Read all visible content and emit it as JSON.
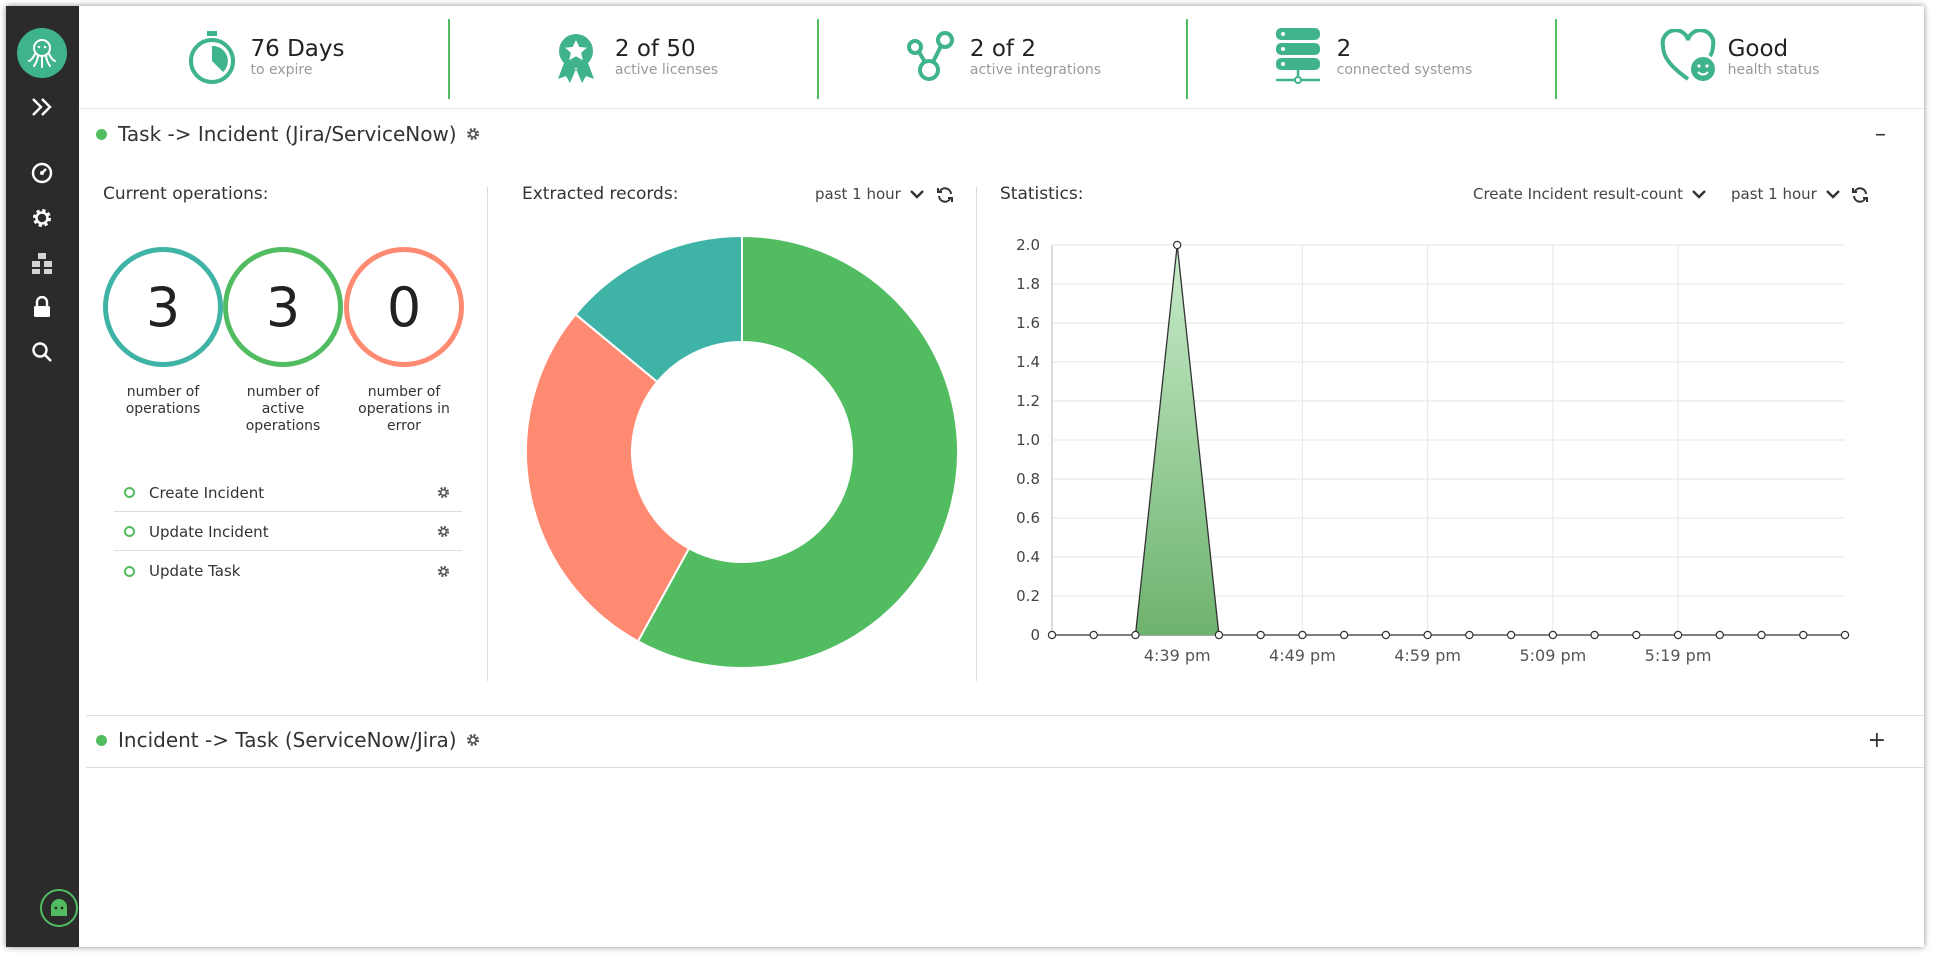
{
  "stats": [
    {
      "big": "76 Days",
      "small": "to expire",
      "icon": "stopwatch-icon"
    },
    {
      "big": "2 of 50",
      "small": "active licenses",
      "icon": "award-ribbon-icon"
    },
    {
      "big": "2 of 2",
      "small": "active integrations",
      "icon": "integration-nodes-icon"
    },
    {
      "big": "2",
      "small": "connected systems",
      "icon": "server-stack-icon"
    },
    {
      "big": "Good",
      "small": "health status",
      "icon": "heart-smile-icon"
    }
  ],
  "sidebar": {
    "items": [
      "expand-icon",
      "dashboard-gauge-icon",
      "settings-gear-icon",
      "modules-blocks-icon",
      "lock-icon",
      "search-icon"
    ]
  },
  "panel1": {
    "title": "Task -> Incident (Jira/ServiceNow)",
    "toggle": "–",
    "current_ops_label": "Current operations:",
    "extracted_label": "Extracted records:",
    "extracted_range": "past 1 hour",
    "statistics_label": "Statistics:",
    "stat_metric": "Create Incident result-count",
    "stat_range": "past 1 hour",
    "counters": [
      {
        "value": "3",
        "caption": "number of operations",
        "color": "#3fb3a5"
      },
      {
        "value": "3",
        "caption": "number of active operations",
        "color": "#52bd60"
      },
      {
        "value": "0",
        "caption": "number of operations in error",
        "color": "#ff8a72"
      }
    ],
    "operations": [
      "Create Incident",
      "Update Incident",
      "Update Task"
    ]
  },
  "panel2": {
    "title": "Incident -> Task (ServiceNow/Jira)",
    "toggle": "+"
  },
  "colors": {
    "accent": "#52bd60",
    "teal": "#3fb3a5",
    "salmon": "#ff8a72",
    "sidebar": "#2b2b2b"
  },
  "chart_data": [
    {
      "type": "pie",
      "title": "Extracted records:",
      "donut": true,
      "slices": [
        {
          "value": 58,
          "color": "#52bd60"
        },
        {
          "value": 28,
          "color": "#ff8a72"
        },
        {
          "value": 14,
          "color": "#3fb3a5"
        }
      ]
    },
    {
      "type": "area",
      "title": "Statistics:",
      "x_tick_labels": [
        "4:39 pm",
        "4:49 pm",
        "4:59 pm",
        "5:09 pm",
        "5:19 pm"
      ],
      "x_tick_positions": [
        3,
        6,
        9,
        12,
        15
      ],
      "y_ticks": [
        "0",
        "0.2",
        "0.4",
        "0.6",
        "0.8",
        "1.0",
        "1.2",
        "1.4",
        "1.6",
        "1.8",
        "2.0"
      ],
      "ylim": [
        0,
        2
      ],
      "values": [
        0,
        0,
        0,
        2,
        0,
        0,
        0,
        0,
        0,
        0,
        0,
        0,
        0,
        0,
        0,
        0,
        0,
        0,
        0,
        0
      ],
      "grid": true
    }
  ]
}
